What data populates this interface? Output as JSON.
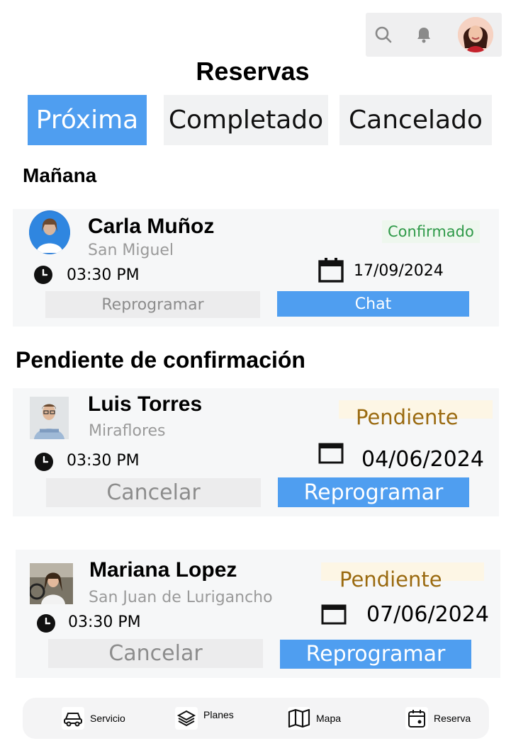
{
  "header": {
    "title": "Reservas"
  },
  "icons": {
    "search": "search-icon",
    "bell": "bell-icon",
    "avatar": "user-avatar"
  },
  "tabs": [
    {
      "label": "Próxima",
      "active": true
    },
    {
      "label": "Completado",
      "active": false
    },
    {
      "label": "Cancelado",
      "active": false
    }
  ],
  "sections": {
    "tomorrow": "Mañana",
    "pending": "Pendiente de confirmación"
  },
  "bookings": [
    {
      "name": "Carla Muñoz",
      "location": "San Miguel",
      "status": "Confirmado",
      "time": "03:30 PM",
      "date": "17/09/2024",
      "secondary_action": "Reprogramar",
      "primary_action": "Chat"
    },
    {
      "name": "Luis Torres",
      "location": "Miraflores",
      "status": "Pendiente",
      "time": "03:30 PM",
      "date": "04/06/2024",
      "secondary_action": "Cancelar",
      "primary_action": "Reprogramar"
    },
    {
      "name": "Mariana Lopez",
      "location": "San Juan de Lurigancho",
      "status": "Pendiente",
      "time": "03:30 PM",
      "date": "07/06/2024",
      "secondary_action": "Cancelar",
      "primary_action": "Reprogramar"
    }
  ],
  "bottom_nav": [
    {
      "label": "Servicio",
      "icon": "car-icon"
    },
    {
      "label": "Planes",
      "icon": "layers-icon"
    },
    {
      "label": "Mapa",
      "icon": "map-icon"
    },
    {
      "label": "Reserva",
      "icon": "calendar-icon"
    }
  ],
  "colors": {
    "accent": "#4f9ef0",
    "confirmed": "#2f9a49",
    "pending": "#9a6a10"
  }
}
